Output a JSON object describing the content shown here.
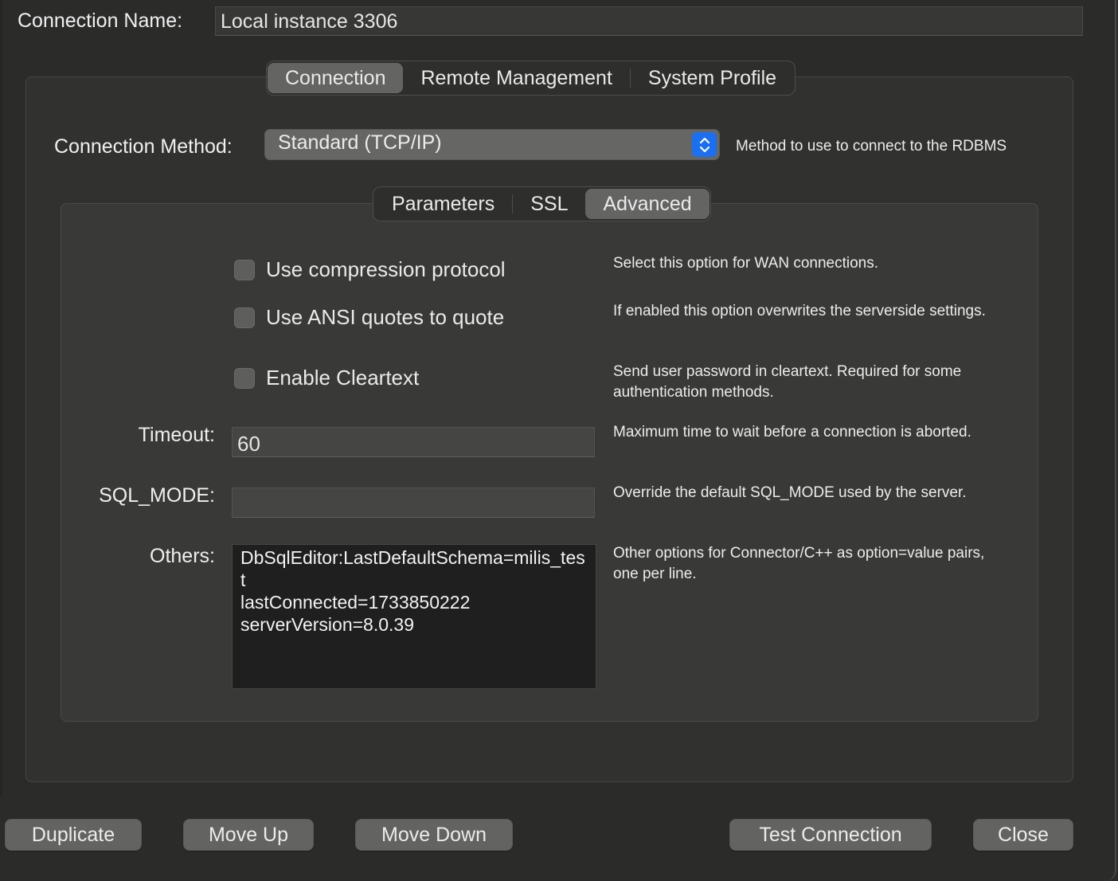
{
  "connection_name": {
    "label": "Connection Name:",
    "value": "Local instance 3306"
  },
  "outer_tabs": [
    {
      "label": "Connection",
      "active": true
    },
    {
      "label": "Remote Management",
      "active": false
    },
    {
      "label": "System Profile",
      "active": false
    }
  ],
  "connection_method": {
    "label": "Connection Method:",
    "value": "Standard (TCP/IP)",
    "help": "Method to use to connect to the RDBMS",
    "stepper_icon": "up-down-chevron-icon"
  },
  "inner_tabs": [
    {
      "label": "Parameters",
      "active": false
    },
    {
      "label": "SSL",
      "active": false
    },
    {
      "label": "Advanced",
      "active": true
    }
  ],
  "options": [
    {
      "label": "Use compression protocol",
      "checked": false,
      "help": "Select this option for WAN connections."
    },
    {
      "label": "Use ANSI quotes to quote",
      "checked": false,
      "help": "If enabled this option overwrites the serverside settings."
    },
    {
      "label": "Enable Cleartext",
      "checked": false,
      "help": "Send user password in cleartext. Required for some authentication methods."
    }
  ],
  "timeout": {
    "label": "Timeout:",
    "value": "60",
    "help": "Maximum time to wait before a connection is aborted."
  },
  "sql_mode": {
    "label": "SQL_MODE:",
    "value": "",
    "help": "Override the default SQL_MODE used by the server."
  },
  "others": {
    "label": "Others:",
    "value": "DbSqlEditor:LastDefaultSchema=milis_test\nlastConnected=1733850222\nserverVersion=8.0.39",
    "help": "Other options for Connector/C++ as option=value pairs, one per line."
  },
  "buttons": {
    "duplicate": "Duplicate",
    "move_up": "Move Up",
    "move_down": "Move Down",
    "test_connection": "Test Connection",
    "close": "Close"
  },
  "colors": {
    "accent": "#1a6ff2",
    "background": "#2b2b2a",
    "panel": "#393938"
  }
}
